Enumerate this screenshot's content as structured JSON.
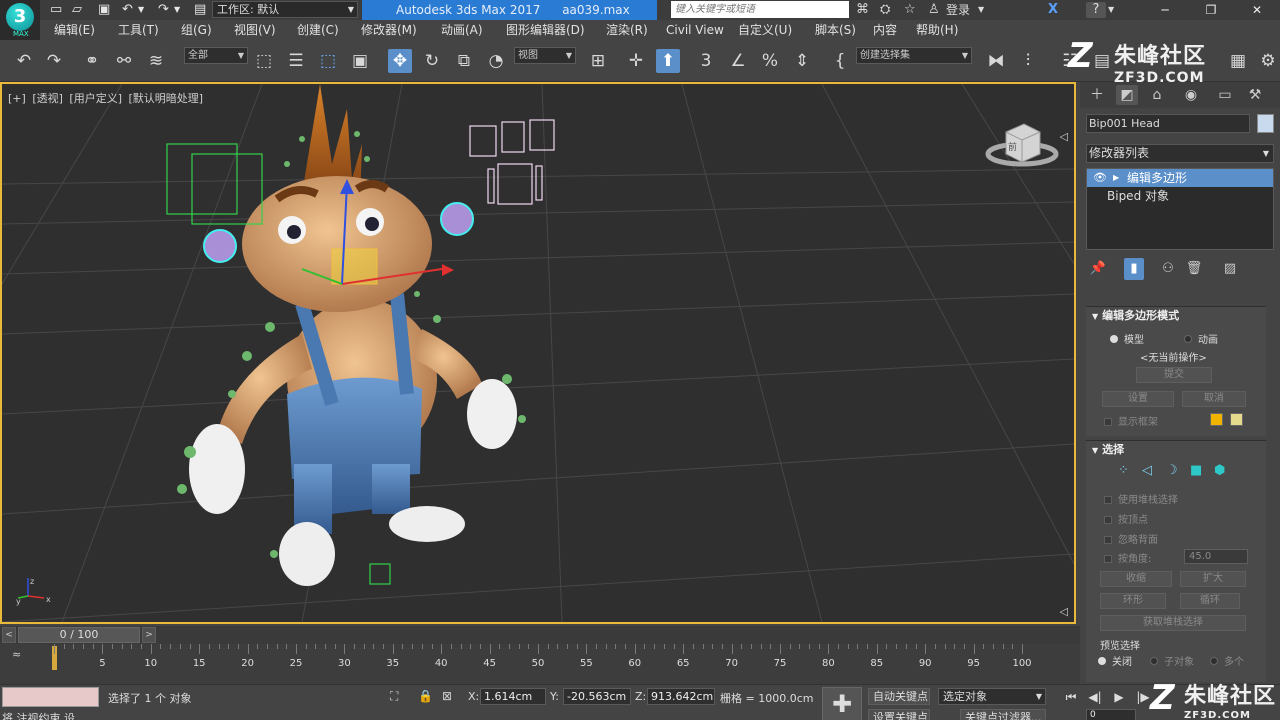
{
  "titlebar": {
    "logo": "3",
    "logo_sub": "MAX",
    "workspace": "工作区: 默认",
    "app_title": "Autodesk 3ds Max 2017",
    "file_name": "aa039.max",
    "search_placeholder": "键入关键字或短语",
    "login": "登录",
    "help": "?"
  },
  "menu": [
    "编辑(E)",
    "工具(T)",
    "组(G)",
    "视图(V)",
    "创建(C)",
    "修改器(M)",
    "动画(A)",
    "图形编辑器(D)",
    "渲染(R)",
    "Civil View",
    "自定义(U)",
    "脚本(S)",
    "内容",
    "帮助(H)"
  ],
  "toolbar": {
    "selection_filter": "全部",
    "ref_coord": "视图",
    "named_selection": "创建选择集"
  },
  "viewport": {
    "labels": [
      "[+]",
      "[透视]",
      "[用户定义]",
      "[默认明暗处理]"
    ],
    "viewcube_label": "前",
    "axis_x": "x",
    "axis_y": "y",
    "axis_z": "z"
  },
  "command_panel": {
    "object_name": "Bip001 Head",
    "object_color": "#c9d9ee",
    "modifier_list": "修改器列表",
    "stack": [
      "编辑多边形",
      "Biped 对象"
    ],
    "edit_poly_mode": {
      "title": "编辑多边形模式",
      "model": "模型",
      "animate": "动画",
      "no_op": "<无当前操作>",
      "commit": "提交",
      "settings": "设置",
      "cancel": "取消",
      "show_cage": "显示框架",
      "cage_color_1": "#f0b400",
      "cage_color_2": "#e6da8c"
    },
    "selection": {
      "title": "选择",
      "use_stack": "使用堆栈选择",
      "by_vertex": "按顶点",
      "ignore_back": "忽略背面",
      "by_angle": "按角度:",
      "angle_value": "45.0",
      "shrink": "收缩",
      "grow": "扩大",
      "ring": "环形",
      "loop": "循环",
      "get_stack": "获取堆栈选择",
      "preview": "预览选择",
      "off": "关闭",
      "subobject": "子对象",
      "multi": "多个"
    }
  },
  "timeline": {
    "position": "0 / 100",
    "ticks": [
      "5",
      "10",
      "15",
      "20",
      "25",
      "30",
      "35",
      "40",
      "45",
      "50",
      "55",
      "60",
      "65",
      "70",
      "75",
      "80",
      "85",
      "90",
      "95",
      "100"
    ]
  },
  "status": {
    "message": "选择了 1 个 对象",
    "prompt": "将 注视约束 设",
    "x_label": "X:",
    "x_value": "1.614cm",
    "y_label": "Y:",
    "y_value": "-20.563cm",
    "z_label": "Z:",
    "z_value": "913.642cm",
    "grid": "栅格 = 1000.0cm",
    "auto_key": "自动关键点",
    "selected": "选定对象",
    "set_key": "设置关键点",
    "key_filters": "关键点过滤器...",
    "frame": "0"
  },
  "watermark": {
    "name": "朱峰社区",
    "url": "ZF3D.COM"
  }
}
